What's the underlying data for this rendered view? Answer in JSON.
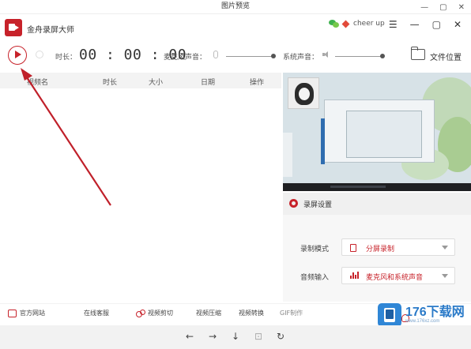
{
  "viewer": {
    "title": "图片预览",
    "controls": [
      "—",
      "▢",
      "✕"
    ]
  },
  "app": {
    "name": "金舟录屏大师",
    "user_name": "cheer up",
    "window_controls": [
      "☰",
      "—",
      "▢",
      "✕"
    ]
  },
  "toolbar": {
    "duration_label": "时长：",
    "timer": "00 : 00 : 00",
    "mic_label": "麦克风声音：",
    "mic_level": 1.0,
    "system_label": "系统声音：",
    "system_level": 1.0,
    "folder_label": "文件位置"
  },
  "table": {
    "columns": [
      "视频名",
      "时长",
      "大小",
      "日期",
      "操作"
    ]
  },
  "settings": {
    "title": "录屏设置",
    "mode_label": "录制模式",
    "mode_value": "分屏录制",
    "audio_label": "音频输入",
    "audio_value": "麦克风和系统声音"
  },
  "footer": {
    "items": [
      "官方网站",
      "在线客服",
      "视频剪切",
      "视频压缩",
      "视频转换",
      "GIF制作"
    ]
  },
  "viewer_bar": {
    "buttons": [
      "←",
      "→",
      "↓",
      "⊡",
      "↻"
    ]
  },
  "watermark": {
    "brand": "176下载网",
    "url": "www.176xz.com"
  },
  "colors": {
    "accent": "#c7222a",
    "arrow": "#c0202a",
    "brand_blue": "#2f86d6"
  }
}
